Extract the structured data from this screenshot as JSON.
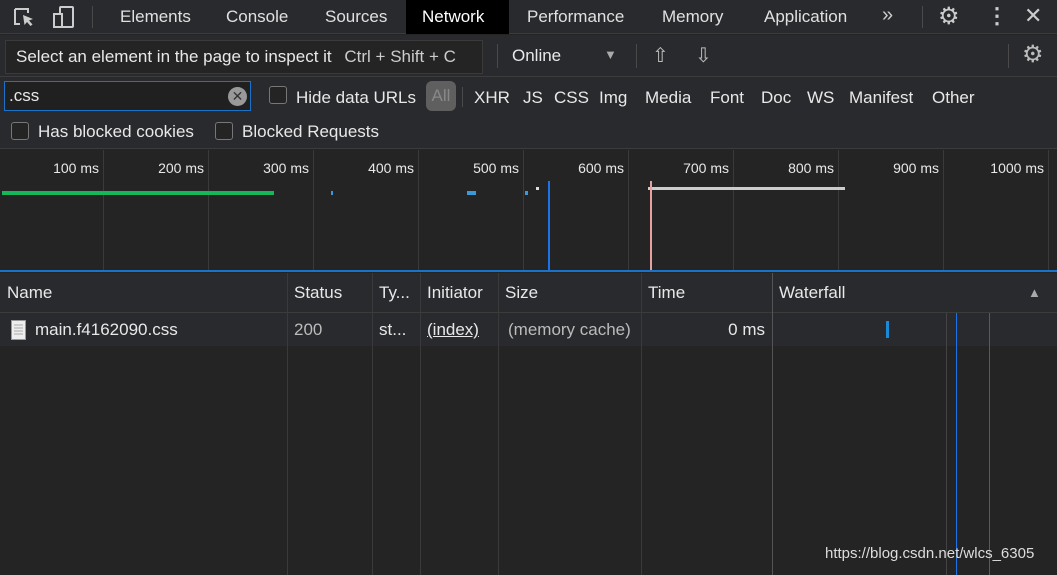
{
  "tabs": [
    {
      "label": "Elements"
    },
    {
      "label": "Console"
    },
    {
      "label": "Sources"
    },
    {
      "label": "Network",
      "active": true
    },
    {
      "label": "Performance"
    },
    {
      "label": "Memory"
    },
    {
      "label": "Application"
    }
  ],
  "tooltip": {
    "text": "Select an element in the page to inspect it",
    "shortcut": "Ctrl + Shift + C"
  },
  "throttle": {
    "value": "Online"
  },
  "filter": {
    "value": ".css",
    "hide_data_urls": "Hide data URLs",
    "types": [
      "All",
      "XHR",
      "JS",
      "CSS",
      "Img",
      "Media",
      "Font",
      "Doc",
      "WS",
      "Manifest",
      "Other"
    ],
    "active_type": "All"
  },
  "checks": {
    "blocked_cookies": "Has blocked cookies",
    "blocked_requests": "Blocked Requests"
  },
  "timeline": {
    "ticks": [
      "100 ms",
      "200 ms",
      "300 ms",
      "400 ms",
      "500 ms",
      "600 ms",
      "700 ms",
      "800 ms",
      "900 ms",
      "1000 ms"
    ]
  },
  "columns": {
    "name": "Name",
    "status": "Status",
    "type": "Ty...",
    "initiator": "Initiator",
    "size": "Size",
    "time": "Time",
    "waterfall": "Waterfall"
  },
  "rows": [
    {
      "name": "main.f4162090.css",
      "status": "200",
      "type": "st...",
      "initiator": "(index)",
      "size": "(memory cache)",
      "time": "0 ms"
    }
  ],
  "watermark": "https://blog.csdn.net/wlcs_6305",
  "colors": {
    "accent": "#1a73c8",
    "green": "#14b85a",
    "dom_line": "#1a73e8",
    "load_line": "#e8a0a0"
  }
}
